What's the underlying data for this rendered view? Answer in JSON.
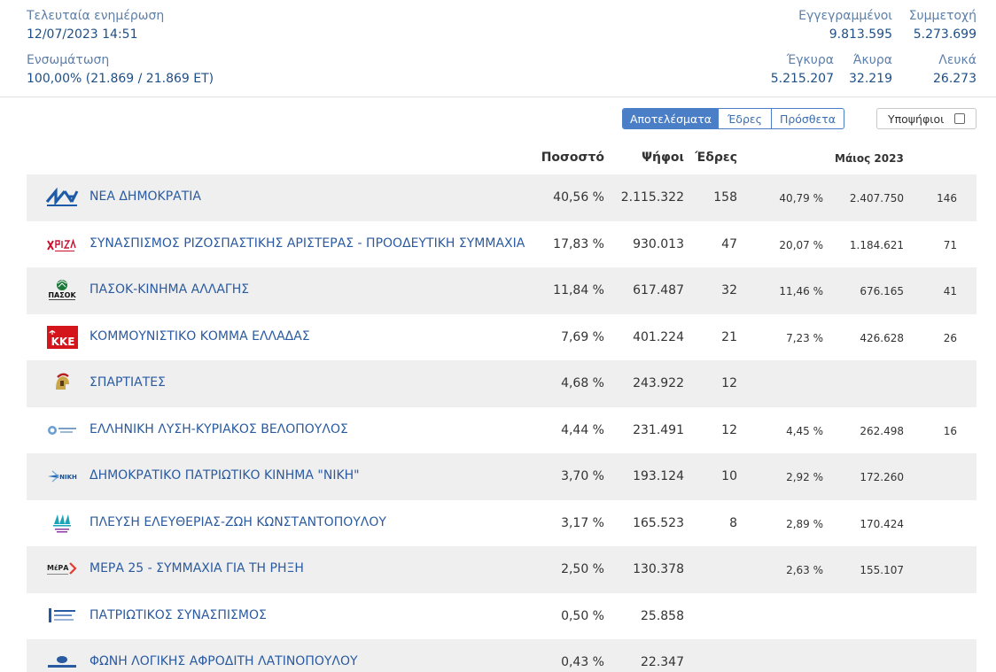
{
  "header": {
    "last_update_label": "Τελευταία ενημέρωση",
    "last_update_value": "12/07/2023 14:51",
    "incorporation_label": "Ενσωμάτωση",
    "incorporation_value": "100,00% (21.869 / 21.869 ΕΤ)",
    "registered_label": "Εγγεγραμμένοι",
    "registered_value": "9.813.595",
    "turnout_label": "Συμμετοχή",
    "turnout_value": "5.273.699",
    "valid_label": "Έγκυρα",
    "valid_value": "5.215.207",
    "invalid_label": "Άκυρα",
    "invalid_value": "32.219",
    "blank_label": "Λευκά",
    "blank_value": "26.273"
  },
  "controls": {
    "tabs": [
      "Αποτελέσματα",
      "Έδρες",
      "Πρόσθετα"
    ],
    "active_tab": "Αποτελέσματα",
    "candidates_label": "Υποψήφιοι",
    "candidates_checked": false
  },
  "columns": {
    "percent": "Ποσοστό",
    "votes": "Ψήφοι",
    "seats": "Έδρες",
    "previous": "Μάιος 2023"
  },
  "colors": {
    "accent": "#4a7fc8",
    "party_link": "#2a5aa0",
    "row_alt": "#efefef"
  },
  "parties": [
    {
      "name": "ΝΕΑ ΔΗΜΟΚΡΑΤΙΑ",
      "logo": "nd-logo-icon",
      "percent": "40,56 %",
      "votes": "2.115.322",
      "seats": "158",
      "prev_percent": "40,79 %",
      "prev_votes": "2.407.750",
      "prev_seats": "146"
    },
    {
      "name": "ΣΥΝΑΣΠΙΣΜΟΣ ΡΙΖΟΣΠΑΣΤΙΚΗΣ ΑΡΙΣΤΕΡΑΣ - ΠΡΟΟΔΕΥΤΙΚΗ ΣΥΜΜΑΧΙΑ",
      "logo": "syriza-logo-icon",
      "percent": "17,83 %",
      "votes": "930.013",
      "seats": "47",
      "prev_percent": "20,07 %",
      "prev_votes": "1.184.621",
      "prev_seats": "71"
    },
    {
      "name": "ΠΑΣΟΚ-ΚΙΝΗΜΑ ΑΛΛΑΓΗΣ",
      "logo": "pasok-logo-icon",
      "percent": "11,84 %",
      "votes": "617.487",
      "seats": "32",
      "prev_percent": "11,46 %",
      "prev_votes": "676.165",
      "prev_seats": "41"
    },
    {
      "name": "ΚΟΜΜΟΥΝΙΣΤΙΚΟ ΚΟΜΜΑ ΕΛΛΑΔΑΣ",
      "logo": "kke-logo-icon",
      "percent": "7,69 %",
      "votes": "401.224",
      "seats": "21",
      "prev_percent": "7,23 %",
      "prev_votes": "426.628",
      "prev_seats": "26"
    },
    {
      "name": "ΣΠΑΡΤΙΑΤΕΣ",
      "logo": "spartiates-logo-icon",
      "percent": "4,68 %",
      "votes": "243.922",
      "seats": "12",
      "prev_percent": "",
      "prev_votes": "",
      "prev_seats": ""
    },
    {
      "name": "ΕΛΛΗΝΙΚΗ ΛΥΣΗ-ΚΥΡΙΑΚΟΣ ΒΕΛΟΠΟΥΛΟΣ",
      "logo": "elliniki-lysi-logo-icon",
      "percent": "4,44 %",
      "votes": "231.491",
      "seats": "12",
      "prev_percent": "4,45 %",
      "prev_votes": "262.498",
      "prev_seats": "16"
    },
    {
      "name": "ΔΗΜΟΚΡΑΤΙΚΟ ΠΑΤΡΙΩΤΙΚΟ ΚΙΝΗΜΑ \"ΝΙΚΗ\"",
      "logo": "niki-logo-icon",
      "percent": "3,70 %",
      "votes": "193.124",
      "seats": "10",
      "prev_percent": "2,92 %",
      "prev_votes": "172.260",
      "prev_seats": ""
    },
    {
      "name": "ΠΛΕΥΣΗ ΕΛΕΥΘΕΡΙΑΣ-ΖΩΗ ΚΩΝΣΤΑΝΤΟΠΟΥΛΟΥ",
      "logo": "plefsi-logo-icon",
      "percent": "3,17 %",
      "votes": "165.523",
      "seats": "8",
      "prev_percent": "2,89 %",
      "prev_votes": "170.424",
      "prev_seats": ""
    },
    {
      "name": "ΜΕΡΑ 25 - ΣΥΜΜΑΧΙΑ ΓΙΑ ΤΗ ΡΗΞΗ",
      "logo": "mera25-logo-icon",
      "percent": "2,50 %",
      "votes": "130.378",
      "seats": "",
      "prev_percent": "2,63 %",
      "prev_votes": "155.107",
      "prev_seats": ""
    },
    {
      "name": "ΠΑΤΡΙΩΤΙΚΟΣ ΣΥΝΑΣΠΙΣΜΟΣ",
      "logo": "patriotikos-logo-icon",
      "percent": "0,50 %",
      "votes": "25.858",
      "seats": "",
      "prev_percent": "",
      "prev_votes": "",
      "prev_seats": ""
    },
    {
      "name": "ΦΩΝΗ ΛΟΓΙΚΗΣ ΑΦΡΟΔΙΤΗ ΛΑΤΙΝΟΠΟΥΛΟΥ",
      "logo": "foni-logikis-logo-icon",
      "percent": "0,43 %",
      "votes": "22.347",
      "seats": "",
      "prev_percent": "",
      "prev_votes": "",
      "prev_seats": ""
    }
  ]
}
